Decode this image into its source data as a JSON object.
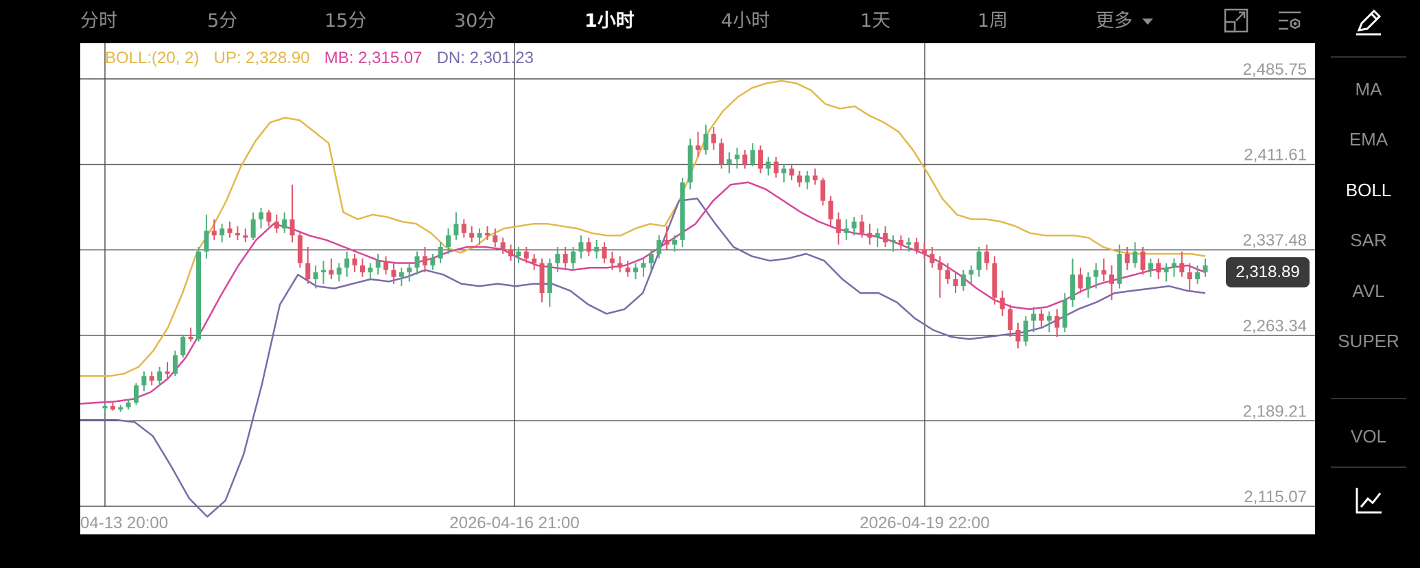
{
  "toolbar": {
    "timeframes": [
      "分时",
      "5分",
      "15分",
      "30分",
      "1小时",
      "4小时",
      "1天",
      "1周",
      "更多"
    ],
    "active": "1小时",
    "icons": [
      "fullscreen-icon",
      "settings-icon"
    ]
  },
  "indicator_legend": {
    "name": "BOLL:(20, 2)",
    "up": "UP: 2,328.90",
    "mb": "MB: 2,315.07",
    "dn": "DN: 2,301.23"
  },
  "price_axis": [
    "2,485.75",
    "2,411.61",
    "2,337.48",
    "2,263.34",
    "2,189.21",
    "2,115.07"
  ],
  "time_axis": [
    "04-13 20:00",
    "2026-04-16 21:00",
    "2026-04-19 22:00"
  ],
  "current_price": "2,318.89",
  "sidebar": {
    "items": [
      "MA",
      "EMA",
      "BOLL",
      "SAR",
      "AVL",
      "SUPER",
      "VOL"
    ],
    "active": "BOLL",
    "icons": [
      "pencil-icon",
      "indicator-chart-icon"
    ]
  },
  "colors": {
    "up": "#4caf7a",
    "down": "#e0556a",
    "boll_up": "#e3b84a",
    "boll_mb": "#d6469b",
    "boll_dn": "#7a6aa8",
    "grid": "#555555"
  },
  "chart_data": {
    "type": "candlestick",
    "ylim": [
      2115.07,
      2485.75
    ],
    "yticks": [
      2485.75,
      2411.61,
      2337.48,
      2263.34,
      2189.21,
      2115.07
    ],
    "x_tick_labels": [
      "04-13 20:00",
      "2026-04-16 21:00",
      "2026-04-19 22:00"
    ],
    "candles": [
      [
        2200,
        2204,
        2196,
        2202
      ],
      [
        2202,
        2206,
        2198,
        2199
      ],
      [
        2199,
        2203,
        2197,
        2201
      ],
      [
        2201,
        2208,
        2199,
        2205
      ],
      [
        2205,
        2222,
        2203,
        2220
      ],
      [
        2220,
        2232,
        2215,
        2228
      ],
      [
        2228,
        2232,
        2220,
        2224
      ],
      [
        2224,
        2236,
        2220,
        2232
      ],
      [
        2232,
        2240,
        2226,
        2230
      ],
      [
        2230,
        2250,
        2228,
        2246
      ],
      [
        2246,
        2264,
        2244,
        2262
      ],
      [
        2262,
        2270,
        2258,
        2260
      ],
      [
        2260,
        2340,
        2258,
        2336
      ],
      [
        2336,
        2368,
        2330,
        2354
      ],
      [
        2354,
        2364,
        2346,
        2350
      ],
      [
        2350,
        2360,
        2344,
        2356
      ],
      [
        2356,
        2362,
        2348,
        2352
      ],
      [
        2352,
        2358,
        2346,
        2350
      ],
      [
        2350,
        2356,
        2344,
        2348
      ],
      [
        2348,
        2370,
        2346,
        2364
      ],
      [
        2364,
        2374,
        2356,
        2370
      ],
      [
        2370,
        2372,
        2358,
        2362
      ],
      [
        2362,
        2368,
        2352,
        2356
      ],
      [
        2356,
        2370,
        2352,
        2364
      ],
      [
        2364,
        2394,
        2344,
        2350
      ],
      [
        2350,
        2354,
        2322,
        2326
      ],
      [
        2326,
        2340,
        2308,
        2312
      ],
      [
        2312,
        2324,
        2304,
        2318
      ],
      [
        2318,
        2328,
        2308,
        2320
      ],
      [
        2320,
        2330,
        2312,
        2316
      ],
      [
        2316,
        2326,
        2310,
        2322
      ],
      [
        2322,
        2336,
        2314,
        2330
      ],
      [
        2330,
        2334,
        2318,
        2324
      ],
      [
        2324,
        2330,
        2314,
        2318
      ],
      [
        2318,
        2326,
        2312,
        2322
      ],
      [
        2322,
        2334,
        2316,
        2328
      ],
      [
        2328,
        2332,
        2316,
        2320
      ],
      [
        2320,
        2326,
        2308,
        2314
      ],
      [
        2314,
        2322,
        2306,
        2318
      ],
      [
        2318,
        2326,
        2310,
        2322
      ],
      [
        2322,
        2336,
        2316,
        2332
      ],
      [
        2332,
        2340,
        2318,
        2324
      ],
      [
        2324,
        2334,
        2320,
        2330
      ],
      [
        2330,
        2344,
        2326,
        2340
      ],
      [
        2340,
        2356,
        2334,
        2350
      ],
      [
        2350,
        2370,
        2346,
        2360
      ],
      [
        2360,
        2364,
        2348,
        2352
      ],
      [
        2352,
        2358,
        2344,
        2348
      ],
      [
        2348,
        2356,
        2342,
        2352
      ],
      [
        2352,
        2358,
        2346,
        2350
      ],
      [
        2350,
        2356,
        2340,
        2344
      ],
      [
        2344,
        2348,
        2334,
        2338
      ],
      [
        2338,
        2342,
        2328,
        2332
      ],
      [
        2332,
        2340,
        2326,
        2336
      ],
      [
        2336,
        2340,
        2326,
        2330
      ],
      [
        2330,
        2334,
        2320,
        2326
      ],
      [
        2326,
        2330,
        2292,
        2300
      ],
      [
        2300,
        2330,
        2288,
        2326
      ],
      [
        2326,
        2340,
        2318,
        2334
      ],
      [
        2334,
        2340,
        2322,
        2326
      ],
      [
        2326,
        2340,
        2320,
        2336
      ],
      [
        2336,
        2350,
        2330,
        2344
      ],
      [
        2344,
        2348,
        2332,
        2336
      ],
      [
        2336,
        2346,
        2330,
        2340
      ],
      [
        2340,
        2344,
        2326,
        2330
      ],
      [
        2330,
        2336,
        2320,
        2326
      ],
      [
        2326,
        2332,
        2318,
        2322
      ],
      [
        2322,
        2328,
        2314,
        2318
      ],
      [
        2318,
        2326,
        2312,
        2322
      ],
      [
        2322,
        2330,
        2314,
        2326
      ],
      [
        2326,
        2338,
        2320,
        2334
      ],
      [
        2334,
        2350,
        2330,
        2346
      ],
      [
        2346,
        2358,
        2338,
        2342
      ],
      [
        2342,
        2350,
        2336,
        2346
      ],
      [
        2346,
        2400,
        2340,
        2396
      ],
      [
        2396,
        2434,
        2390,
        2428
      ],
      [
        2428,
        2440,
        2418,
        2424
      ],
      [
        2424,
        2446,
        2420,
        2438
      ],
      [
        2438,
        2444,
        2424,
        2430
      ],
      [
        2430,
        2434,
        2408,
        2412
      ],
      [
        2412,
        2422,
        2404,
        2416
      ],
      [
        2416,
        2426,
        2408,
        2420
      ],
      [
        2420,
        2424,
        2408,
        2412
      ],
      [
        2412,
        2430,
        2410,
        2424
      ],
      [
        2424,
        2428,
        2404,
        2408
      ],
      [
        2408,
        2418,
        2402,
        2414
      ],
      [
        2414,
        2418,
        2400,
        2404
      ],
      [
        2404,
        2412,
        2396,
        2408
      ],
      [
        2408,
        2412,
        2398,
        2402
      ],
      [
        2402,
        2406,
        2392,
        2396
      ],
      [
        2396,
        2406,
        2390,
        2402
      ],
      [
        2402,
        2408,
        2394,
        2398
      ],
      [
        2398,
        2400,
        2376,
        2380
      ],
      [
        2380,
        2384,
        2358,
        2364
      ],
      [
        2364,
        2370,
        2342,
        2352
      ],
      [
        2352,
        2364,
        2346,
        2356
      ],
      [
        2356,
        2366,
        2350,
        2362
      ],
      [
        2362,
        2368,
        2348,
        2352
      ],
      [
        2352,
        2360,
        2342,
        2348
      ],
      [
        2348,
        2356,
        2340,
        2352
      ],
      [
        2352,
        2358,
        2340,
        2344
      ],
      [
        2344,
        2350,
        2336,
        2346
      ],
      [
        2346,
        2350,
        2338,
        2342
      ],
      [
        2342,
        2348,
        2336,
        2344
      ],
      [
        2344,
        2348,
        2334,
        2338
      ],
      [
        2338,
        2344,
        2330,
        2334
      ],
      [
        2334,
        2340,
        2322,
        2326
      ],
      [
        2326,
        2332,
        2296,
        2320
      ],
      [
        2320,
        2326,
        2308,
        2312
      ],
      [
        2312,
        2318,
        2300,
        2306
      ],
      [
        2306,
        2320,
        2302,
        2316
      ],
      [
        2316,
        2324,
        2308,
        2320
      ],
      [
        2320,
        2340,
        2314,
        2336
      ],
      [
        2336,
        2342,
        2320,
        2326
      ],
      [
        2326,
        2332,
        2290,
        2296
      ],
      [
        2296,
        2302,
        2280,
        2286
      ],
      [
        2286,
        2290,
        2262,
        2268
      ],
      [
        2268,
        2274,
        2252,
        2258
      ],
      [
        2258,
        2280,
        2254,
        2276
      ],
      [
        2276,
        2288,
        2266,
        2282
      ],
      [
        2282,
        2286,
        2270,
        2276
      ],
      [
        2276,
        2284,
        2266,
        2280
      ],
      [
        2280,
        2286,
        2262,
        2270
      ],
      [
        2270,
        2300,
        2266,
        2294
      ],
      [
        2294,
        2330,
        2288,
        2316
      ],
      [
        2316,
        2322,
        2300,
        2304
      ],
      [
        2304,
        2318,
        2296,
        2314
      ],
      [
        2314,
        2326,
        2304,
        2320
      ],
      [
        2320,
        2330,
        2310,
        2316
      ],
      [
        2316,
        2324,
        2294,
        2308
      ],
      [
        2308,
        2342,
        2304,
        2334
      ],
      [
        2334,
        2340,
        2320,
        2326
      ],
      [
        2326,
        2344,
        2322,
        2336
      ],
      [
        2336,
        2340,
        2316,
        2320
      ],
      [
        2320,
        2330,
        2314,
        2326
      ],
      [
        2326,
        2330,
        2312,
        2318
      ],
      [
        2318,
        2326,
        2310,
        2322
      ],
      [
        2322,
        2330,
        2314,
        2326
      ],
      [
        2326,
        2336,
        2314,
        2318
      ],
      [
        2318,
        2326,
        2302,
        2312
      ],
      [
        2312,
        2324,
        2308,
        2318
      ],
      [
        2318,
        2330,
        2314,
        2324
      ]
    ],
    "boll_up": [
      2228,
      2228,
      2228,
      2230,
      2236,
      2250,
      2270,
      2300,
      2336,
      2356,
      2380,
      2410,
      2432,
      2448,
      2452,
      2450,
      2440,
      2430,
      2370,
      2364,
      2368,
      2366,
      2362,
      2360,
      2352,
      2340,
      2335,
      2340,
      2350,
      2356,
      2358,
      2360,
      2360,
      2358,
      2356,
      2352,
      2350,
      2350,
      2356,
      2360,
      2358,
      2380,
      2410,
      2440,
      2458,
      2470,
      2478,
      2482,
      2484,
      2482,
      2476,
      2464,
      2460,
      2462,
      2454,
      2448,
      2440,
      2424,
      2404,
      2382,
      2368,
      2364,
      2364,
      2362,
      2358,
      2352,
      2350,
      2350,
      2350,
      2348,
      2340,
      2336,
      2334,
      2334,
      2334,
      2334,
      2334,
      2332
    ],
    "boll_mb": [
      2204,
      2205,
      2206,
      2208,
      2214,
      2226,
      2244,
      2270,
      2298,
      2324,
      2346,
      2360,
      2356,
      2350,
      2346,
      2340,
      2334,
      2328,
      2326,
      2326,
      2330,
      2336,
      2340,
      2340,
      2338,
      2330,
      2324,
      2322,
      2320,
      2322,
      2322,
      2324,
      2330,
      2340,
      2350,
      2360,
      2380,
      2394,
      2396,
      2390,
      2380,
      2370,
      2362,
      2356,
      2352,
      2350,
      2346,
      2340,
      2334,
      2326,
      2316,
      2304,
      2294,
      2288,
      2286,
      2288,
      2294,
      2302,
      2308,
      2312,
      2316,
      2320,
      2322,
      2324,
      2318
    ],
    "boll_dn": [
      2190,
      2190,
      2190,
      2188,
      2176,
      2150,
      2122,
      2106,
      2120,
      2160,
      2220,
      2290,
      2316,
      2306,
      2304,
      2308,
      2312,
      2310,
      2314,
      2320,
      2316,
      2308,
      2306,
      2308,
      2306,
      2308,
      2308,
      2302,
      2290,
      2282,
      2286,
      2300,
      2340,
      2380,
      2382,
      2360,
      2340,
      2332,
      2328,
      2330,
      2334,
      2328,
      2312,
      2300,
      2300,
      2292,
      2278,
      2268,
      2262,
      2260,
      2262,
      2264,
      2266,
      2270,
      2278,
      2286,
      2292,
      2300,
      2302,
      2304,
      2306,
      2302,
      2300
    ]
  }
}
